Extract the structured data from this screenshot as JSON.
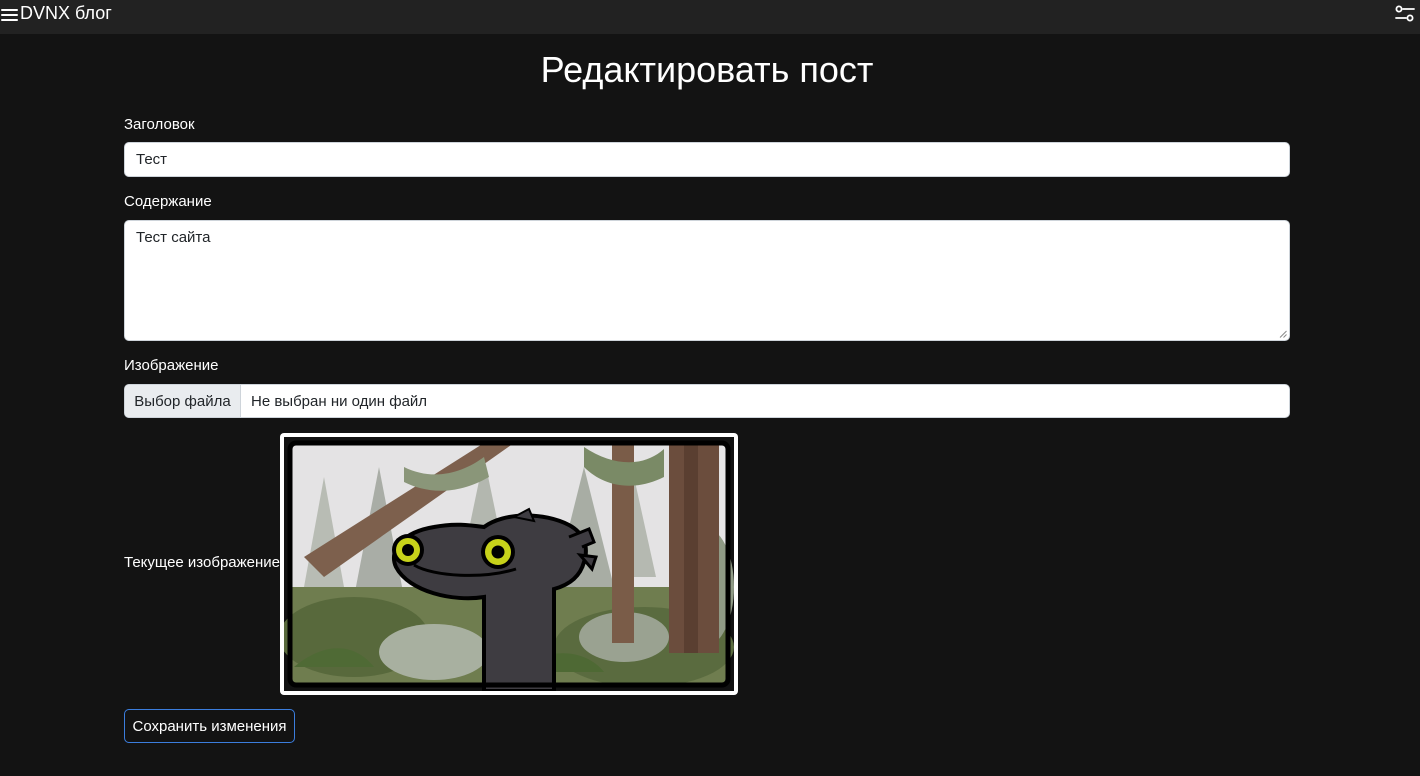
{
  "navbar": {
    "brand": "DVNX блог",
    "menu_icon": "hamburger-menu-icon",
    "settings_icon": "sliders-settings-icon"
  },
  "page": {
    "title": "Редактировать пост"
  },
  "form": {
    "title_label": "Заголовок",
    "title_value": "Тест",
    "content_label": "Содержание",
    "content_value": "Тест сайта",
    "image_label": "Изображение",
    "file_button_label": "Выбор файла",
    "file_status": "Не выбран ни один файл",
    "current_image_label": "Текущее изображение:",
    "save_button_label": "Сохранить изменения"
  },
  "colors": {
    "page_background": "#131313",
    "navbar_background": "#222222",
    "save_button_border": "#3b7ddd"
  }
}
